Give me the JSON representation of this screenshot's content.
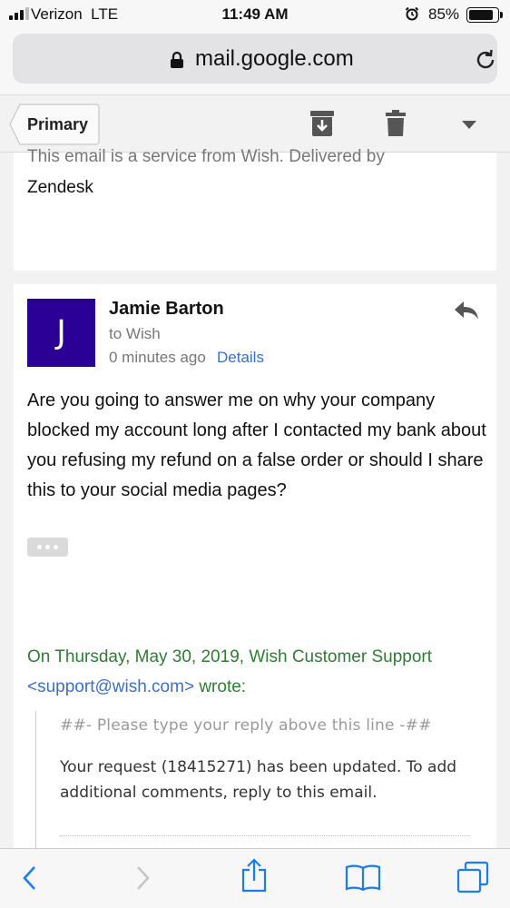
{
  "status_bar": {
    "carrier": "Verizon",
    "network": "LTE",
    "time": "11:49 AM",
    "battery": "85%",
    "battery_level": 0.85
  },
  "browser": {
    "url": "mail.google.com"
  },
  "toolbar": {
    "back_label": "Primary",
    "icons": [
      "archive-icon",
      "trash-icon",
      "dropdown-icon"
    ]
  },
  "previous_message": {
    "truncated_line": "This email is a service from Wish. Delivered by",
    "tail": "Zendesk"
  },
  "message": {
    "avatar_letter": "J",
    "avatar_color": "#2b0094",
    "sender": "Jamie Barton",
    "recipient": "to Wish",
    "time": "0 minutes ago",
    "details_link": "Details",
    "body": "Are you going to answer me on why your company blocked my account long after I contacted my bank about you refusing my refund on a false order or should I share this to your social media pages?",
    "quote_intro": "On Thursday, May 30, 2019, Wish Customer Support",
    "quote_email": "<support@wish.com>",
    "quote_wrote": "wrote:",
    "quote_marker": "##- Please type your reply above this line -##",
    "quote_text": "Your request (18415271) has been updated. To add additional comments, reply to this email."
  },
  "colors": {
    "link": "#3b6fc8",
    "quote_green": "#2e7d32",
    "safari_blue": "#1a7cf5"
  }
}
